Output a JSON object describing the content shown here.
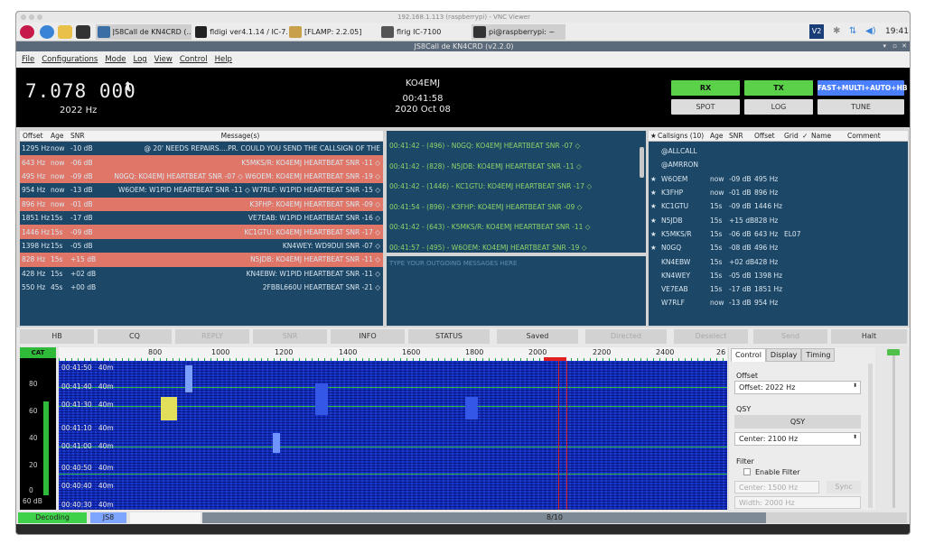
{
  "vnc": {
    "title": "192.168.1.113 (raspberrypi) - VNC Viewer"
  },
  "taskbar": {
    "tasks": [
      "JS8Call de KN4CRD (...",
      "fldigi ver4.1.14 / IC-7...",
      "[FLAMP: 2.2.05]",
      "flrig IC-7100",
      "pi@raspberrypi: ~"
    ],
    "clock": "19:41",
    "vnc_badge": "V2"
  },
  "window": {
    "title": "JS8Call de KN4CRD (v2.2.0)"
  },
  "menu": [
    "File",
    "Configurations",
    "Mode",
    "Log",
    "View",
    "Control",
    "Help"
  ],
  "freq": {
    "dial": "7.078 000",
    "offset": "2022 Hz"
  },
  "station": {
    "call": "KO4EMJ",
    "time": "00:41:58",
    "date": "2020 Oct 08"
  },
  "buttons": {
    "rx": "RX",
    "tx": "TX",
    "mode": "FAST+MULTI+AUTO+HB",
    "spot": "SPOT",
    "log": "LOG",
    "tune": "TUNE"
  },
  "band_activity": {
    "headers": [
      "Offset",
      "Age",
      "SNR",
      "Message(s)"
    ],
    "rows": [
      {
        "offset": "1295 Hz",
        "age": "now",
        "snr": "-10 dB",
        "msg": "@ 20' NEEDS REPAIRS....PR. COULD YOU SEND THE CALLSIGN OF THE",
        "hl": false
      },
      {
        "offset": "643 Hz",
        "age": "now",
        "snr": "-06 dB",
        "msg": "K5MKS/R: KO4EMJ HEARTBEAT SNR -11 ◇",
        "hl": true
      },
      {
        "offset": "495 Hz",
        "age": "now",
        "snr": "-09 dB",
        "msg": "N0GQ: KO4EMJ HEARTBEAT SNR -07 ◇ W6OEM: KO4EMJ HEARTBEAT SNR -19 ◇",
        "hl": true
      },
      {
        "offset": "954 Hz",
        "age": "now",
        "snr": "-13 dB",
        "msg": "W6OEM: W1PID HEARTBEAT SNR -11 ◇ W7RLF: W1PID HEARTBEAT SNR -15 ◇",
        "hl": false
      },
      {
        "offset": "896 Hz",
        "age": "now",
        "snr": "-01 dB",
        "msg": "K3FHP: KO4EMJ HEARTBEAT SNR -09 ◇",
        "hl": true
      },
      {
        "offset": "1851 Hz",
        "age": "15s",
        "snr": "-17 dB",
        "msg": "VE7EAB: W1PID HEARTBEAT SNR -16 ◇",
        "hl": false
      },
      {
        "offset": "1446 Hz",
        "age": "15s",
        "snr": "-09 dB",
        "msg": "KC1GTU: KO4EMJ HEARTBEAT SNR -17 ◇",
        "hl": true
      },
      {
        "offset": "1398 Hz",
        "age": "15s",
        "snr": "-05 dB",
        "msg": "KN4WEY: WD9DUI SNR -07 ◇",
        "hl": false
      },
      {
        "offset": "828 Hz",
        "age": "15s",
        "snr": "+15 dB",
        "msg": "N5JDB: KO4EMJ HEARTBEAT SNR -11 ◇",
        "hl": true
      },
      {
        "offset": "428 Hz",
        "age": "15s",
        "snr": "+02 dB",
        "msg": "KN4EBW: W1PID HEARTBEAT SNR -11 ◇",
        "hl": false
      },
      {
        "offset": "550 Hz",
        "age": "45s",
        "snr": "+00 dB",
        "msg": "2FBBL660U HEARTBEAT SNR -21 ◇",
        "hl": false
      }
    ]
  },
  "rx_text": [
    "00:41:42 - (496) - N0GQ: KO4EMJ HEARTBEAT SNR -07 ◇",
    "00:41:42 - (828) - N5JDB: KO4EMJ HEARTBEAT SNR -11 ◇",
    "00:41:42 - (1446) - KC1GTU: KO4EMJ HEARTBEAT SNR -17 ◇",
    "00:41:54 - (896) - K3FHP: KO4EMJ HEARTBEAT SNR -09 ◇",
    "00:41:42 - (643) - K5MKS/R: KO4EMJ HEARTBEAT SNR -11 ◇",
    "00:41:57 - (495) - W6OEM: KO4EMJ HEARTBEAT SNR -19 ◇"
  ],
  "tx_placeholder": "TYPE YOUR OUTGOING MESSAGES HERE",
  "calls": {
    "headers": [
      "★",
      "Callsigns (10)",
      "Age",
      "SNR",
      "Offset",
      "Grid",
      "✓",
      "Name",
      "Comment"
    ],
    "rows": [
      {
        "star": "",
        "call": "@ALLCALL",
        "age": "",
        "snr": "",
        "offset": "",
        "grid": ""
      },
      {
        "star": "",
        "call": "@AMRRON",
        "age": "",
        "snr": "",
        "offset": "",
        "grid": ""
      },
      {
        "star": "★",
        "call": "W6OEM",
        "age": "now",
        "snr": "-09 dB",
        "offset": "495 Hz",
        "grid": ""
      },
      {
        "star": "★",
        "call": "K3FHP",
        "age": "now",
        "snr": "-01 dB",
        "offset": "896 Hz",
        "grid": ""
      },
      {
        "star": "★",
        "call": "KC1GTU",
        "age": "15s",
        "snr": "-09 dB",
        "offset": "1446 Hz",
        "grid": ""
      },
      {
        "star": "★",
        "call": "N5JDB",
        "age": "15s",
        "snr": "+15 dB",
        "offset": "828 Hz",
        "grid": ""
      },
      {
        "star": "★",
        "call": "K5MKS/R",
        "age": "15s",
        "snr": "-06 dB",
        "offset": "643 Hz",
        "grid": "EL07"
      },
      {
        "star": "★",
        "call": "N0GQ",
        "age": "15s",
        "snr": "-08 dB",
        "offset": "496 Hz",
        "grid": ""
      },
      {
        "star": "",
        "call": "KN4EBW",
        "age": "15s",
        "snr": "+02 dB",
        "offset": "428 Hz",
        "grid": ""
      },
      {
        "star": "",
        "call": "KN4WEY",
        "age": "15s",
        "snr": "-05 dB",
        "offset": "1398 Hz",
        "grid": ""
      },
      {
        "star": "",
        "call": "VE7EAB",
        "age": "15s",
        "snr": "-17 dB",
        "offset": "1851 Hz",
        "grid": ""
      },
      {
        "star": "",
        "call": "W7RLF",
        "age": "now",
        "snr": "-13 dB",
        "offset": "954 Hz",
        "grid": ""
      }
    ]
  },
  "action_buttons": [
    "HB",
    "CQ",
    "REPLY",
    "SNR",
    "INFO",
    "STATUS",
    "Saved",
    "Directed",
    "Deselect",
    "Send",
    "Halt"
  ],
  "meter": {
    "label": "CAT",
    "ticks": [
      "80",
      "60",
      "40",
      "20",
      "0"
    ],
    "reading": "60 dB"
  },
  "waterfall": {
    "scale": [
      "800",
      "1000",
      "1200",
      "1400",
      "1600",
      "1800",
      "2000",
      "2200",
      "2400",
      "26"
    ],
    "times": [
      "00:41:50",
      "00:41:40",
      "00:41:30",
      "00:41:10",
      "00:41:00",
      "00:40:50",
      "00:40:40",
      "00:40:30"
    ],
    "band": "40m"
  },
  "controls": {
    "tabs": [
      "Control",
      "Display",
      "Timing"
    ],
    "offset_label": "Offset",
    "offset_value": "Offset: 2022 Hz",
    "qsy_label": "QSY",
    "qsy_button": "QSY",
    "center_value": "Center: 2100 Hz",
    "filter_label": "Filter",
    "enable_filter": "Enable Filter",
    "filter_center": "Center: 1500 Hz",
    "sync": "Sync",
    "width": "Width: 2000 Hz"
  },
  "status": {
    "decoding": "Decoding",
    "mode": "JS8",
    "progress": "8/10"
  },
  "colors": {
    "table_bg": "#1d4767",
    "highlight": "#e07668",
    "green": "#5bd14a",
    "blue": "#4a7fff",
    "waterfall": "#0f2bb8"
  }
}
